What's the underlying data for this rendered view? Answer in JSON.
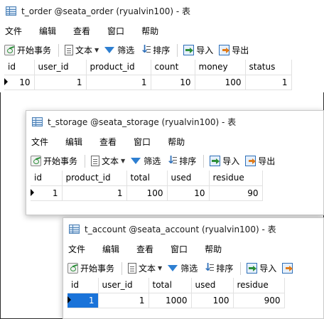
{
  "menu": [
    "文件",
    "编辑",
    "查看",
    "窗口",
    "帮助"
  ],
  "toolbar": {
    "begin_tx": "开始事务",
    "text": "文本",
    "filter": "筛选",
    "sort": "排序",
    "import": "导入",
    "export": "导出"
  },
  "windows": {
    "order": {
      "title": "t_order @seata_order (ryualvin100) - 表",
      "columns": [
        "id",
        "user_id",
        "product_id",
        "count",
        "money",
        "status"
      ],
      "rows": [
        [
          "10",
          "1",
          "1",
          "10",
          "100",
          "1"
        ]
      ]
    },
    "storage": {
      "title": "t_storage @seata_storage (ryualvin100) - 表",
      "columns": [
        "id",
        "product_id",
        "total",
        "used",
        "residue"
      ],
      "rows": [
        [
          "1",
          "1",
          "100",
          "10",
          "90"
        ]
      ]
    },
    "account": {
      "title": "t_account @seata_account (ryualvin100) - 表",
      "columns": [
        "id",
        "user_id",
        "total",
        "used",
        "residue"
      ],
      "rows": [
        [
          "1",
          "1",
          "1000",
          "100",
          "900"
        ]
      ]
    }
  }
}
